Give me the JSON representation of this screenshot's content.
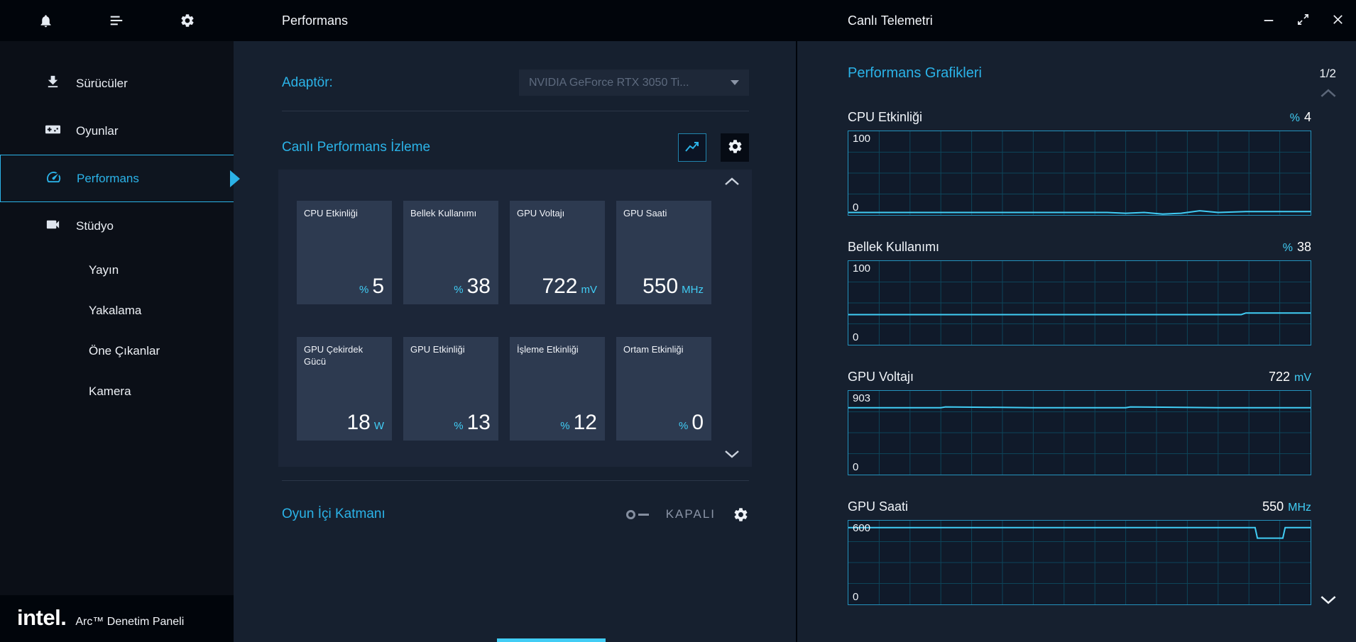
{
  "colors": {
    "accent": "#2bb3e8",
    "trace": "#41cdf5",
    "black": "#01050b",
    "sidebar": "#0b0f17",
    "panel": "#16202f",
    "tilewrap": "#1c2638",
    "tile": "#2d3a50",
    "divider": "#2b3648",
    "grid": "#0d4459",
    "graphborder": "#2492bd",
    "muted": "#8a94a6",
    "disabled": "#5b6678"
  },
  "brand": {
    "logo": "intel.",
    "app_name": "Arc™ Denetim Paneli"
  },
  "sidebar": {
    "topbar_icons": [
      "bell-icon",
      "menu-icon",
      "gear-icon"
    ],
    "items": [
      {
        "label": "Sürücüler",
        "icon": "download-icon"
      },
      {
        "label": "Oyunlar",
        "icon": "gamepad-icon"
      },
      {
        "label": "Performans",
        "icon": "gauge-icon",
        "active": true
      },
      {
        "label": "Stüdyo",
        "icon": "videocam-icon"
      }
    ],
    "subitems": [
      {
        "label": "Yayın"
      },
      {
        "label": "Yakalama"
      },
      {
        "label": "Öne Çıkanlar"
      },
      {
        "label": "Kamera"
      }
    ]
  },
  "performance_panel": {
    "header": "Performans",
    "adapter_label": "Adaptör:",
    "adapter_value": "NVIDIA GeForce RTX 3050 Ti...",
    "monitor_title": "Canlı Performans İzleme",
    "tiles": [
      {
        "label": "CPU Etkinliği",
        "unit": "%",
        "value": "5",
        "unit_position": "before"
      },
      {
        "label": "Bellek Kullanımı",
        "unit": "%",
        "value": "38",
        "unit_position": "before"
      },
      {
        "label": "GPU Voltajı",
        "unit": "mV",
        "value": "722",
        "unit_position": "after"
      },
      {
        "label": "GPU Saati",
        "unit": "MHz",
        "value": "550",
        "unit_position": "after"
      },
      {
        "label": "GPU Çekirdek Gücü",
        "unit": "W",
        "value": "18",
        "unit_position": "after"
      },
      {
        "label": "GPU Etkinliği",
        "unit": "%",
        "value": "13",
        "unit_position": "before"
      },
      {
        "label": "İşleme Etkinliği",
        "unit": "%",
        "value": "12",
        "unit_position": "before"
      },
      {
        "label": "Ortam Etkinliği",
        "unit": "%",
        "value": "0",
        "unit_position": "before"
      }
    ],
    "overlay_title": "Oyun İçi Katmanı",
    "overlay_state": "KAPALI"
  },
  "telemetry_panel": {
    "header": "Canlı Telemetri",
    "window_controls": [
      "minimize-icon",
      "resize-icon",
      "close-icon"
    ],
    "section_title": "Performans Grafikleri",
    "page_indicator": "1/2",
    "charts": [
      {
        "type": "line",
        "title": "CPU Etkinliği",
        "unit": "%",
        "value": "4",
        "unit_position": "before",
        "y_max_label": "100",
        "y_min_label": "0",
        "y_max": 100,
        "points": [
          [
            0,
            3
          ],
          [
            0.1,
            3
          ],
          [
            0.2,
            3
          ],
          [
            0.3,
            3
          ],
          [
            0.4,
            3
          ],
          [
            0.5,
            3
          ],
          [
            0.56,
            3
          ],
          [
            0.6,
            2
          ],
          [
            0.64,
            3
          ],
          [
            0.68,
            1
          ],
          [
            0.72,
            2
          ],
          [
            0.76,
            5
          ],
          [
            0.8,
            3
          ],
          [
            0.86,
            4
          ],
          [
            0.93,
            4
          ],
          [
            1,
            4
          ]
        ]
      },
      {
        "type": "line",
        "title": "Bellek Kullanımı",
        "unit": "%",
        "value": "38",
        "unit_position": "before",
        "y_max_label": "100",
        "y_min_label": "0",
        "y_max": 100,
        "points": [
          [
            0,
            36
          ],
          [
            0.3,
            36
          ],
          [
            0.6,
            36
          ],
          [
            0.85,
            36
          ],
          [
            0.86,
            38
          ],
          [
            1,
            38
          ]
        ]
      },
      {
        "type": "line",
        "title": "GPU Voltajı",
        "unit": "mV",
        "value": "722",
        "unit_position": "after",
        "y_max_label": "903",
        "y_min_label": "0",
        "y_max": 903,
        "points": [
          [
            0,
            722
          ],
          [
            0.2,
            722
          ],
          [
            0.21,
            730
          ],
          [
            0.4,
            722
          ],
          [
            0.6,
            722
          ],
          [
            0.61,
            730
          ],
          [
            0.8,
            722
          ],
          [
            1,
            722
          ]
        ]
      },
      {
        "type": "line",
        "title": "GPU Saati",
        "unit": "MHz",
        "value": "550",
        "unit_position": "after",
        "y_max_label": "600",
        "y_min_label": "0",
        "y_max": 600,
        "points": [
          [
            0,
            550
          ],
          [
            0.5,
            550
          ],
          [
            0.88,
            550
          ],
          [
            0.885,
            475
          ],
          [
            0.94,
            475
          ],
          [
            0.945,
            550
          ],
          [
            1,
            550
          ]
        ]
      }
    ]
  }
}
